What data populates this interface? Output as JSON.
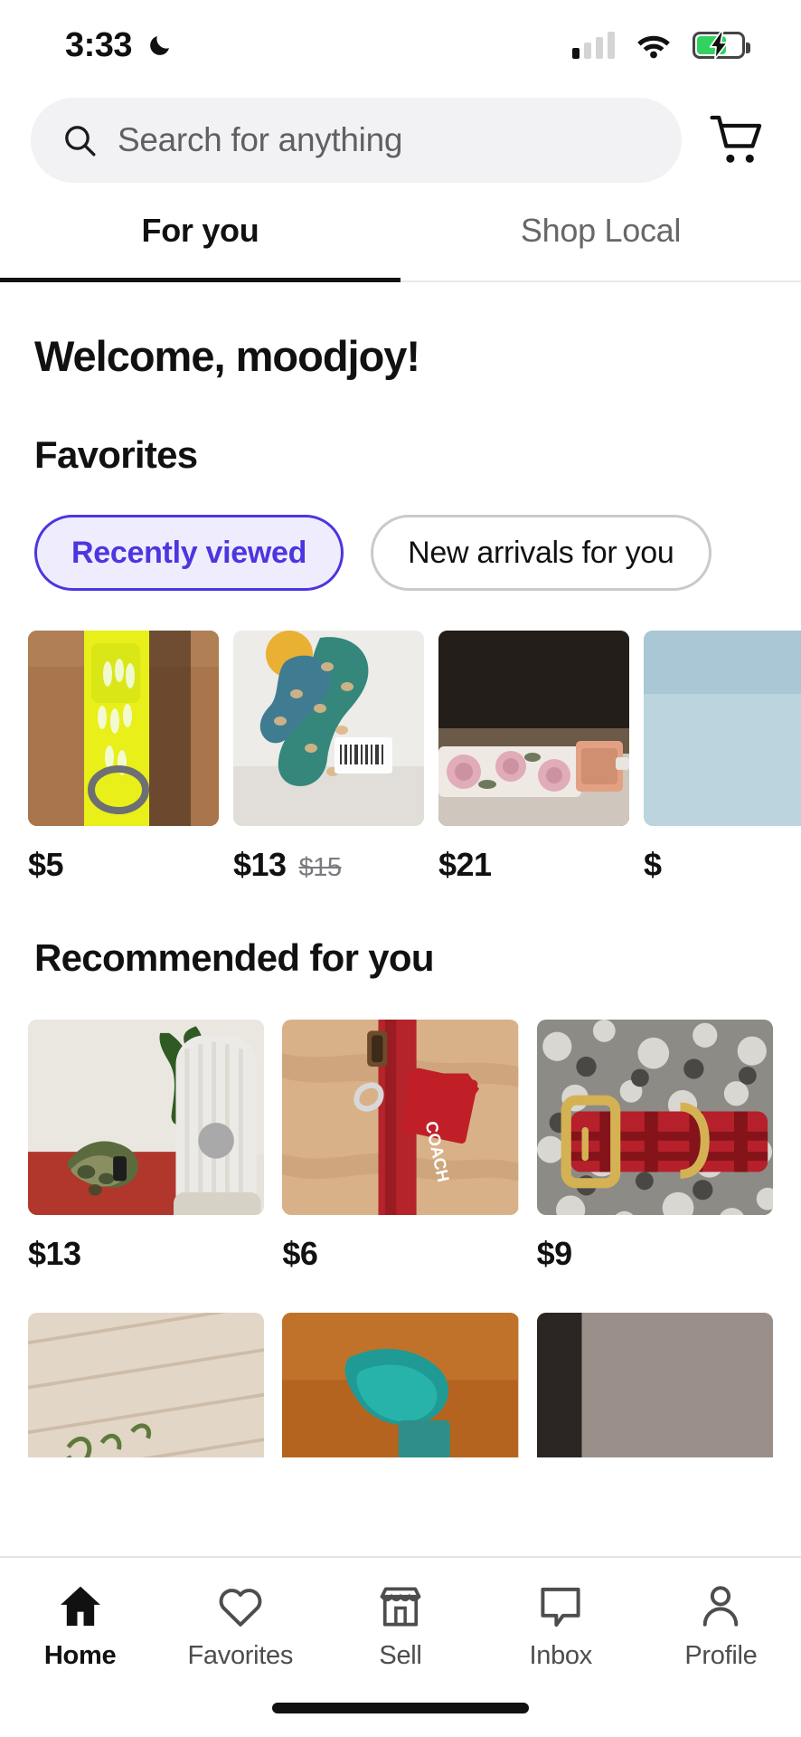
{
  "status_bar": {
    "time": "3:33",
    "moon_icon": "crescent-moon-icon",
    "signal_icon": "cellular-signal-icon",
    "signal_bars_filled": 1,
    "signal_bars_total": 4,
    "wifi_icon": "wifi-icon",
    "battery_icon": "battery-charging-icon",
    "battery_level_percent": 62,
    "battery_color": "#33d15f"
  },
  "search": {
    "placeholder": "Search for anything",
    "icon": "search-icon",
    "cart_icon": "shopping-cart-icon"
  },
  "tabs": [
    {
      "label": "For you",
      "active": true
    },
    {
      "label": "Shop Local",
      "active": false
    }
  ],
  "main": {
    "welcome": "Welcome, moodjoy!",
    "favorites_title": "Favorites",
    "recommended_title": "Recommended for you",
    "chips": [
      {
        "label": "Recently viewed",
        "selected": true
      },
      {
        "label": "New arrivals for you",
        "selected": false
      }
    ],
    "favorites_items": [
      {
        "price": "$5",
        "was": ""
      },
      {
        "price": "$13",
        "was": "$15"
      },
      {
        "price": "$21",
        "was": ""
      },
      {
        "price": "$",
        "was": ""
      }
    ],
    "recommended_items": [
      {
        "price": "$13",
        "was": ""
      },
      {
        "price": "$6",
        "was": ""
      },
      {
        "price": "$9",
        "was": ""
      }
    ]
  },
  "bottom_nav": [
    {
      "label": "Home",
      "icon": "home-icon",
      "active": true
    },
    {
      "label": "Favorites",
      "icon": "heart-icon",
      "active": false
    },
    {
      "label": "Sell",
      "icon": "store-icon",
      "active": false
    },
    {
      "label": "Inbox",
      "icon": "inbox-icon",
      "active": false
    },
    {
      "label": "Profile",
      "icon": "person-icon",
      "active": false
    }
  ],
  "colors": {
    "accent": "#4b36e0",
    "chip_selected_bg": "#efedfd",
    "search_bg": "#f2f2f4",
    "text_primary": "#111111",
    "text_muted": "#676767"
  }
}
